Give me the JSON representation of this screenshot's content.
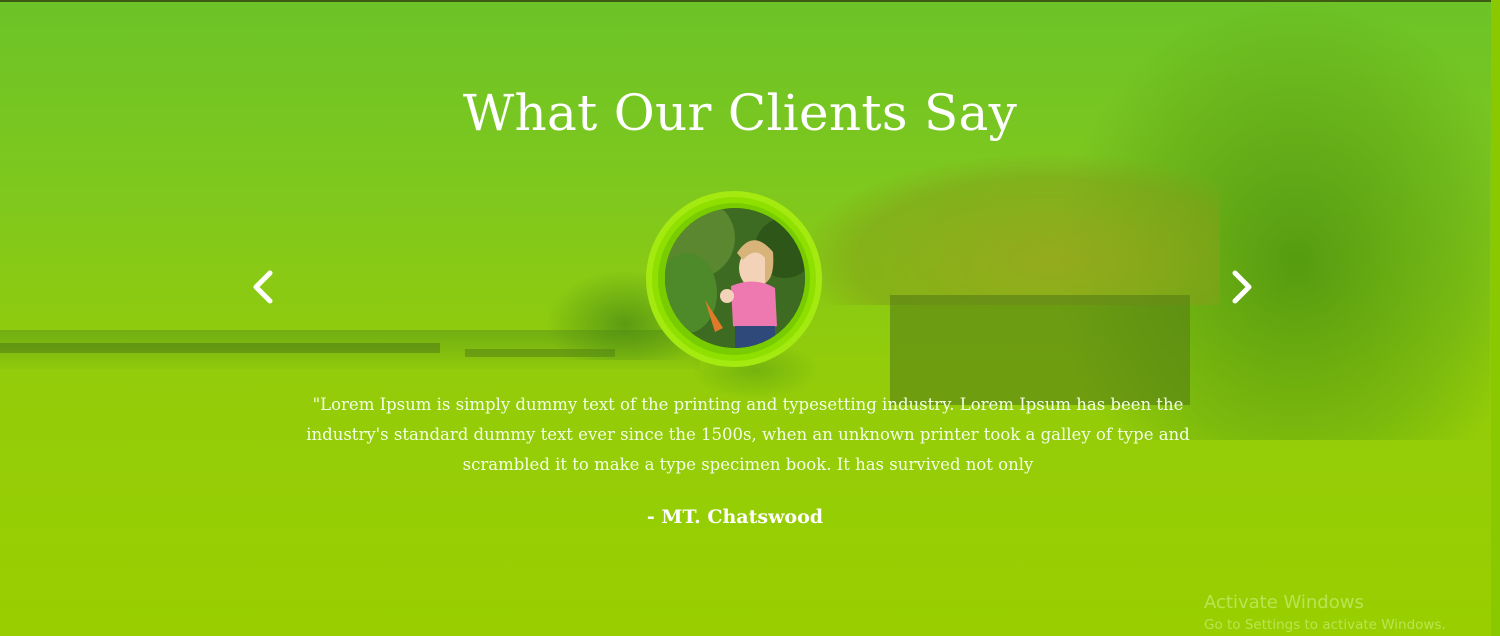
{
  "section": {
    "title": "What Our Clients Say"
  },
  "testimonial": {
    "quote": "\"Lorem Ipsum is simply dummy text of the printing and typesetting industry. Lorem Ipsum has been the industry's standard dummy text ever since the 1500s, when an unknown printer took a galley of type and scrambled it to make a type specimen book. It has survived not only",
    "author": "- MT. Chatswood",
    "avatar_icon": "client-photo"
  },
  "navigation": {
    "prev_icon": "chevron-left-icon",
    "next_icon": "chevron-right-icon"
  },
  "os_watermark": {
    "line1": "Activate Windows",
    "line2": "Go to Settings to activate Windows."
  },
  "colors": {
    "overlay": "#93cc0a",
    "ring": "#a4ea10",
    "text": "#ffffff"
  }
}
